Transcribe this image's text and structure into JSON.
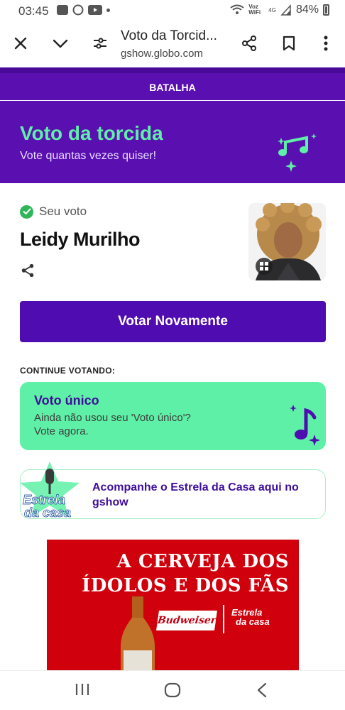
{
  "status": {
    "time": "03:45",
    "network": "Voz WiFi",
    "net4g": "4G",
    "battery": "84%"
  },
  "browser": {
    "title": "Voto da Torcid...",
    "url": "gshow.globo.com",
    "icons": [
      "close-icon",
      "chevron-down-icon",
      "site-settings-icon",
      "share-icon",
      "bookmark-icon",
      "more-icon"
    ]
  },
  "page": {
    "section_tab": "BATALHA",
    "hero": {
      "title": "Voto da torcida",
      "subtitle": "Vote quantas vezes quiser!"
    },
    "vote": {
      "status_label": "Seu voto",
      "candidate": "Leidy Murilho",
      "button": "Votar Novamente"
    },
    "continue_label": "CONTINUE VOTANDO:",
    "voto_unico": {
      "title": "Voto único",
      "line1": "Ainda não usou seu 'Voto único'?",
      "line2": "Vote agora."
    },
    "estrela": {
      "logo_line1": "Estrela",
      "logo_line2": "da casa",
      "text": "Acompanhe o Estrela da Casa aqui no gshow"
    },
    "ad": {
      "line1": "A CERVEJA DOS",
      "line2": "ÍDOLOS E DOS FÃS",
      "brand": "Budweiser",
      "partner_line1": "Estrela",
      "partner_line2": "da casa"
    }
  },
  "colors": {
    "purple": "#5a0fb0",
    "green": "#5ef0a6",
    "button": "#4f0cb0",
    "check": "#2fb65a",
    "ad_red": "#d0000c"
  }
}
